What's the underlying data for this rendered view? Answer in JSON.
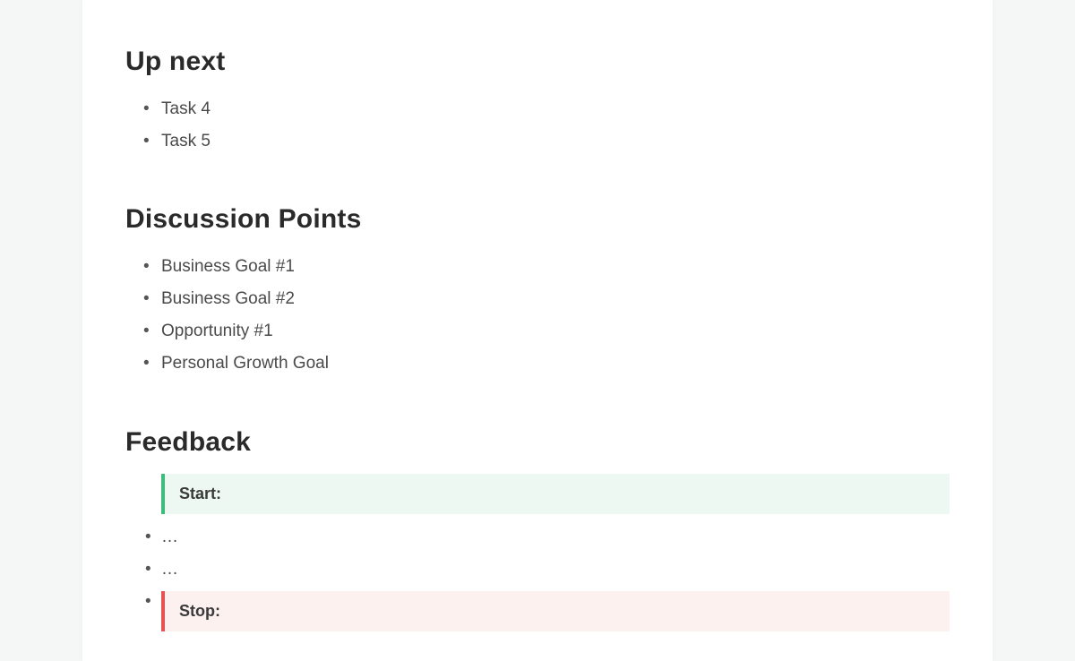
{
  "sections": {
    "up_next": {
      "title": "Up next",
      "items": [
        "Task 4",
        "Task 5"
      ]
    },
    "discussion": {
      "title": "Discussion Points",
      "items": [
        "Business Goal #1",
        "Business Goal #2",
        "Opportunity #1",
        "Personal Growth Goal"
      ]
    },
    "feedback": {
      "title": "Feedback",
      "start_label": "Start:",
      "stop_label": "Stop:",
      "start_items": [
        "…",
        "…",
        ""
      ]
    }
  }
}
